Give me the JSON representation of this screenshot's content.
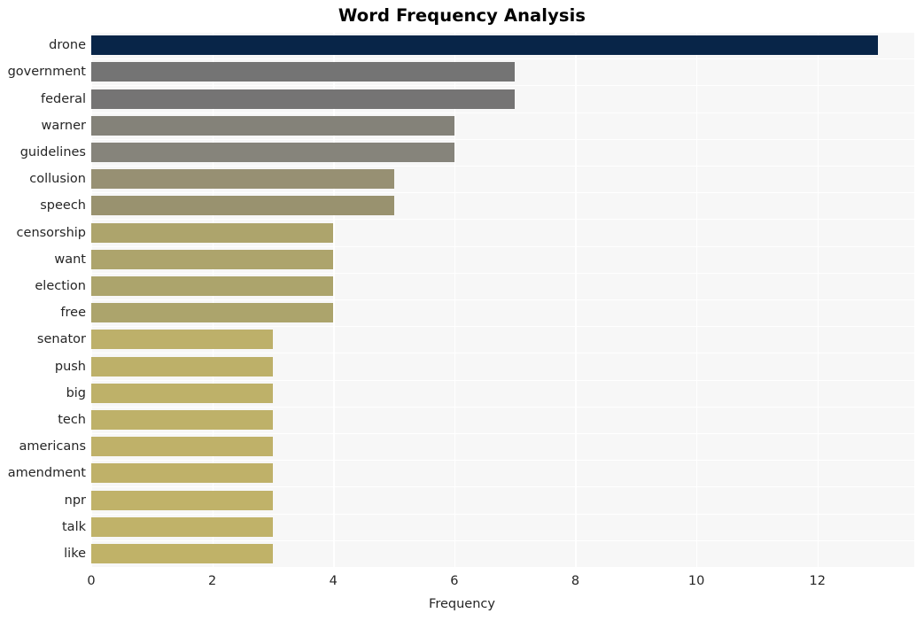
{
  "chart_data": {
    "type": "bar",
    "orientation": "horizontal",
    "title": "Word Frequency Analysis",
    "xlabel": "Frequency",
    "ylabel": "",
    "xlim": [
      0,
      13.6
    ],
    "xticks": [
      0,
      2,
      4,
      6,
      8,
      10,
      12
    ],
    "xtick_labels": [
      "0",
      "2",
      "4",
      "6",
      "8",
      "10",
      "12"
    ],
    "grid": true,
    "grid_axis": "both",
    "legend": "none",
    "categories": [
      "drone",
      "government",
      "federal",
      "warner",
      "guidelines",
      "collusion",
      "speech",
      "censorship",
      "want",
      "election",
      "free",
      "senator",
      "push",
      "big",
      "tech",
      "americans",
      "amendment",
      "npr",
      "talk",
      "like"
    ],
    "values": [
      13,
      7,
      7,
      6,
      6,
      5,
      5,
      4,
      4,
      4,
      4,
      3,
      3,
      3,
      3,
      3,
      3,
      3,
      3,
      3
    ],
    "bar_colors": [
      "#082548",
      "#747474",
      "#757474",
      "#848279",
      "#86847b",
      "#979073",
      "#99926f",
      "#ada46c",
      "#ada46c",
      "#aca46c",
      "#aca46c",
      "#bdb06a",
      "#bdb069",
      "#beb169",
      "#beb169",
      "#bfb169",
      "#bfb169",
      "#c0b269",
      "#c0b269",
      "#c0b268"
    ],
    "plot_background": "#f7f7f7",
    "grid_color": "#ffffff",
    "figure_background": "#ffffff",
    "text_color": "#262626",
    "title_color": "#000000"
  }
}
